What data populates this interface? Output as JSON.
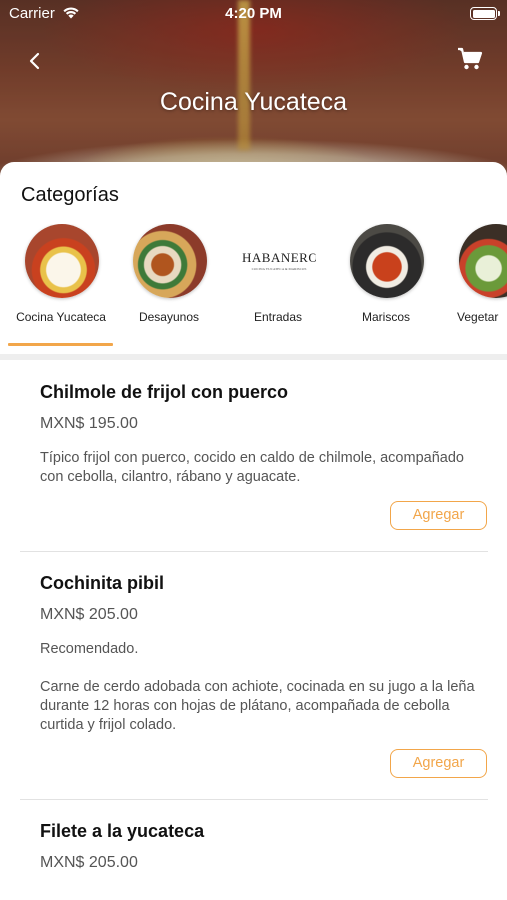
{
  "status_bar": {
    "carrier": "Carrier",
    "time": "4:20 PM"
  },
  "header": {
    "title": "Cocina Yucateca"
  },
  "categories": {
    "heading": "Categorías",
    "items": [
      {
        "label": "Cocina Yucateca",
        "selected": true
      },
      {
        "label": "Desayunos",
        "selected": false
      },
      {
        "label": "Entradas",
        "selected": false,
        "logo_text": "HABANEROS",
        "logo_subtext": "COCINA YUCATECA & MARISCOS"
      },
      {
        "label": "Mariscos",
        "selected": false
      },
      {
        "label": "Vegetar",
        "selected": false
      }
    ]
  },
  "menu": [
    {
      "name": "Chilmole de frijol con puerco",
      "price": "MXN$ 195.00",
      "description": "Típico frijol con puerco, cocido en caldo de chilmole, acompañado con cebolla, cilantro, rábano y aguacate.",
      "button": "Agregar"
    },
    {
      "name": "Cochinita pibil",
      "price": "MXN$ 205.00",
      "note": "Recomendado.",
      "description": "Carne de cerdo adobada con achiote, cocinada en su jugo a la leña durante 12 horas con hojas de plátano, acompañada de cebolla curtida y frijol colado.",
      "button": "Agregar"
    },
    {
      "name": "Filete a la yucateca",
      "price": "MXN$ 205.00"
    }
  ],
  "colors": {
    "accent": "#f2a64a",
    "text_muted": "#555555"
  }
}
